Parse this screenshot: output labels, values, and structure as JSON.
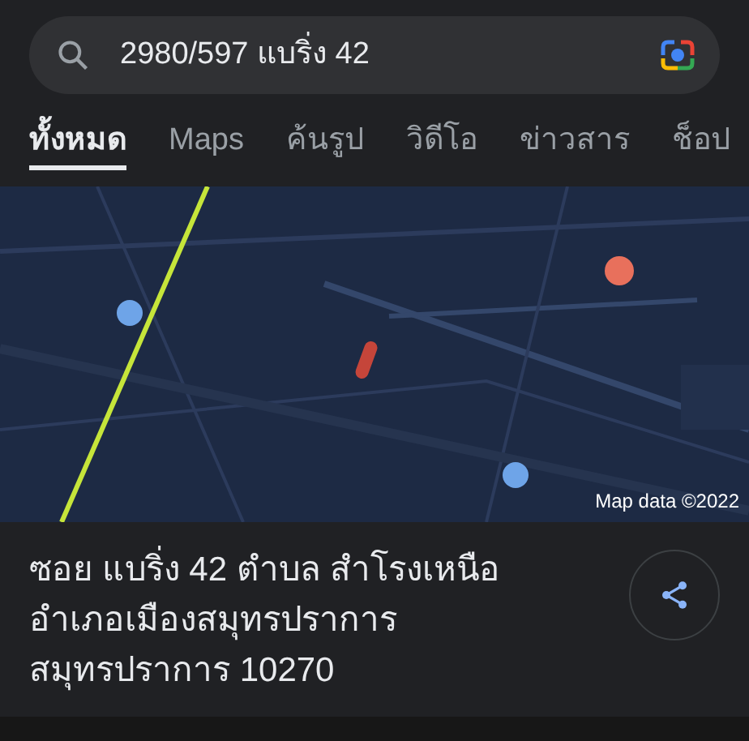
{
  "search": {
    "value": "2980/597 แบริ่ง 42"
  },
  "tabs": [
    {
      "label": "ทั้งหมด",
      "selected": true
    },
    {
      "label": "Maps",
      "selected": false
    },
    {
      "label": "ค้นรูป",
      "selected": false
    },
    {
      "label": "วิดีโอ",
      "selected": false
    },
    {
      "label": "ข่าวสาร",
      "selected": false
    },
    {
      "label": "ช็อป",
      "selected": false
    }
  ],
  "map": {
    "kind": "picture",
    "attribution": "Map data ©2022"
  },
  "place": {
    "address_lines": [
      "ซอย แบริ่ง 42 ตำบล สำโรงเหนือ",
      "อำเภอเมืองสมุทรปราการ",
      "สมุทรปราการ 10270"
    ]
  }
}
